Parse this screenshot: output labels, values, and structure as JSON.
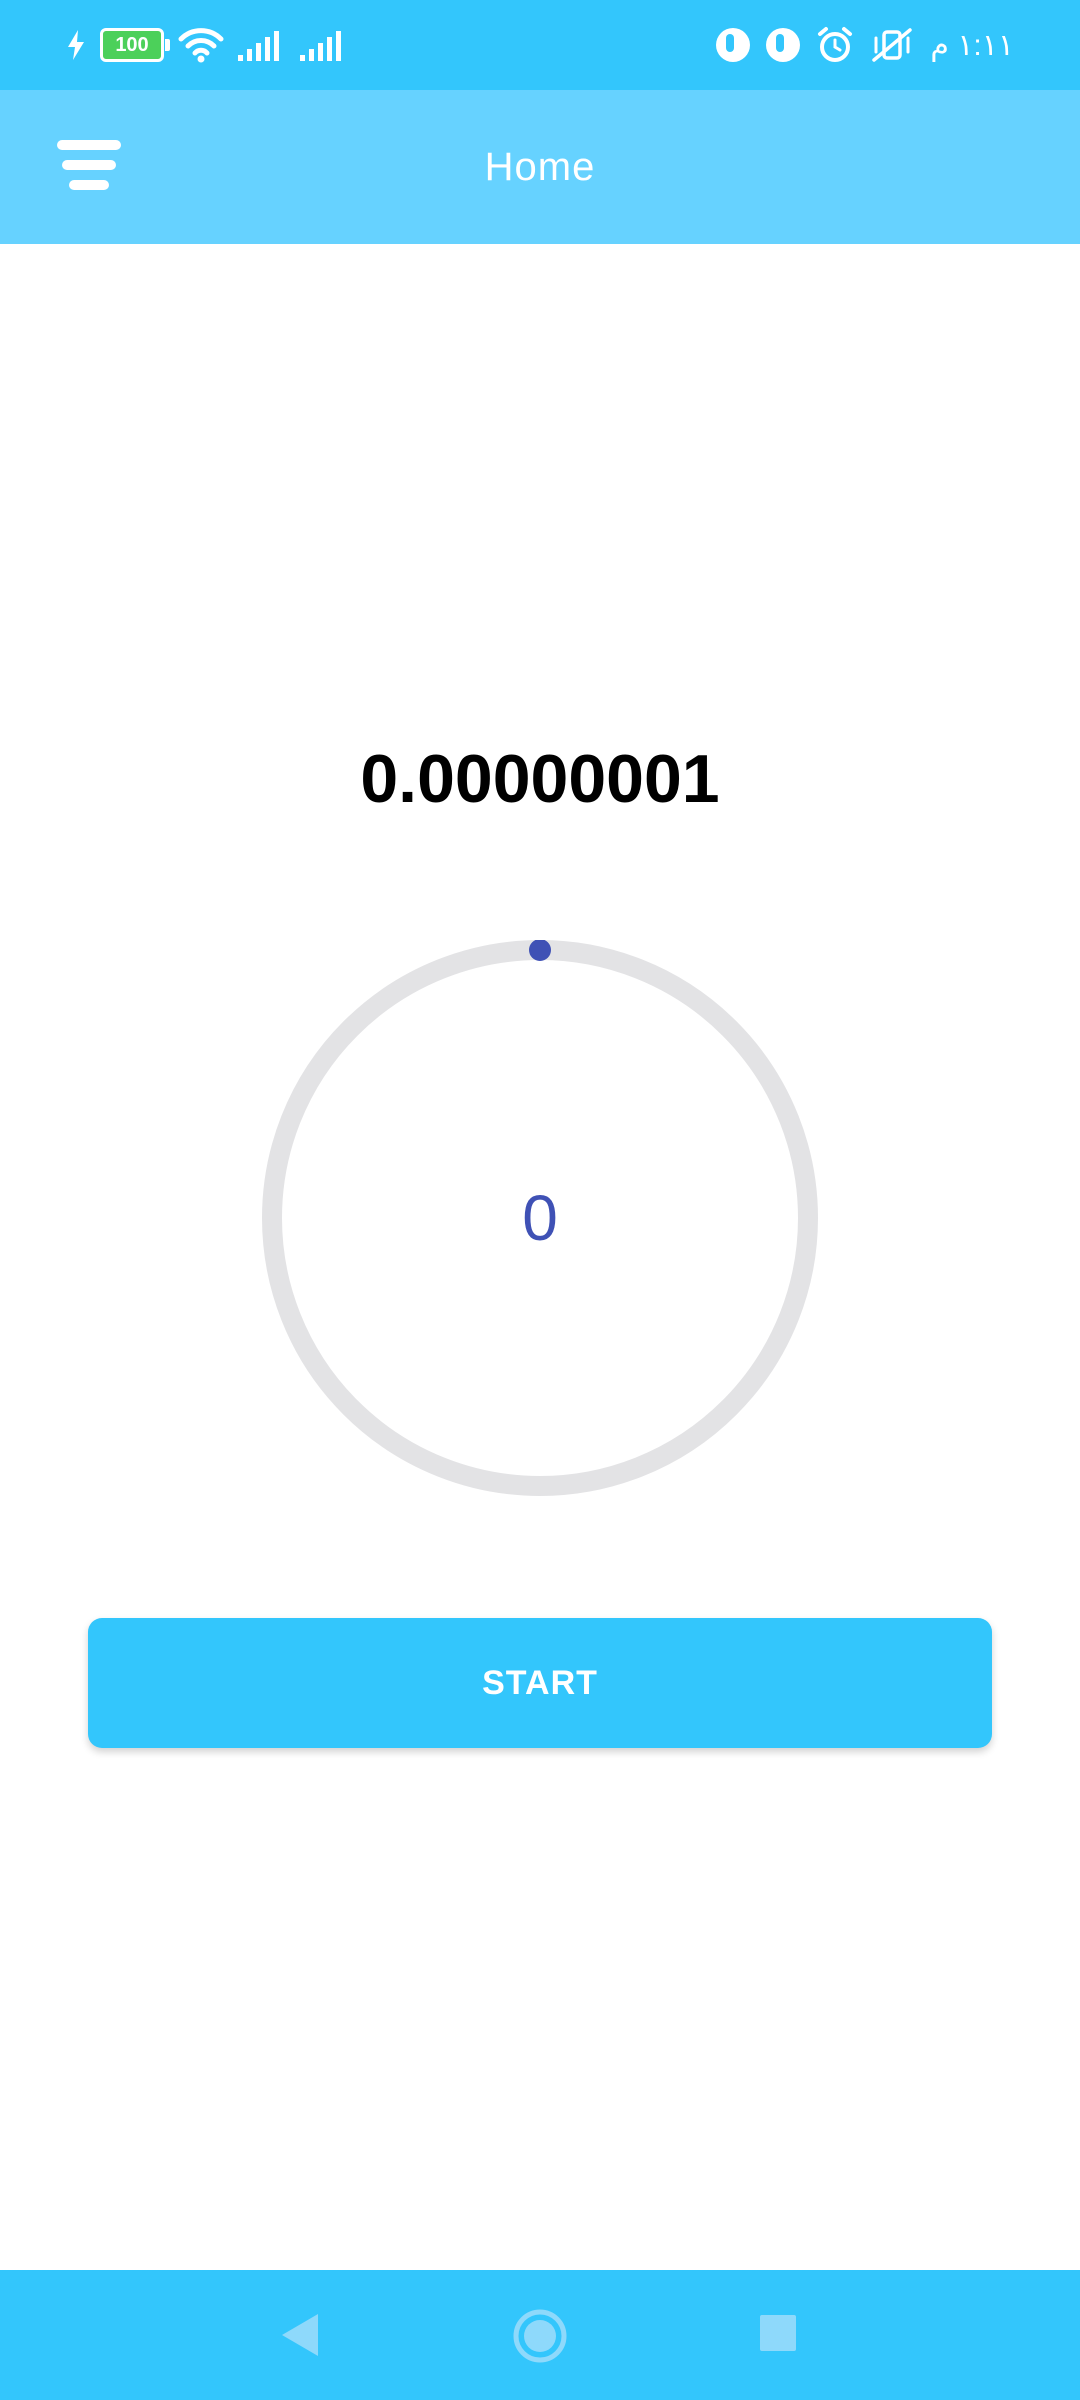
{
  "status_bar": {
    "battery_level": "100",
    "time": "١:١١ م",
    "icons": [
      "charging-bolt-icon",
      "battery-icon",
      "wifi-icon",
      "signal-icon",
      "signal-icon",
      "app-notification-icon",
      "app-notification-icon",
      "alarm-icon",
      "mute-icon"
    ]
  },
  "app_bar": {
    "title": "Home",
    "menu_icon": "menu-icon"
  },
  "main": {
    "balance": "0.00000001",
    "timer_value": "0",
    "timer_progress": 0,
    "start_label": "START"
  },
  "colors": {
    "status_bar": "#33c6fc",
    "app_bar": "#66d2ff",
    "accent": "#33c6fc",
    "ring_track": "#e3e3e5",
    "ring_indicator": "#3f51b5",
    "timer_text": "#3f51b5"
  },
  "nav_bar": {
    "icons": [
      "back-icon",
      "home-icon",
      "recents-icon"
    ]
  }
}
